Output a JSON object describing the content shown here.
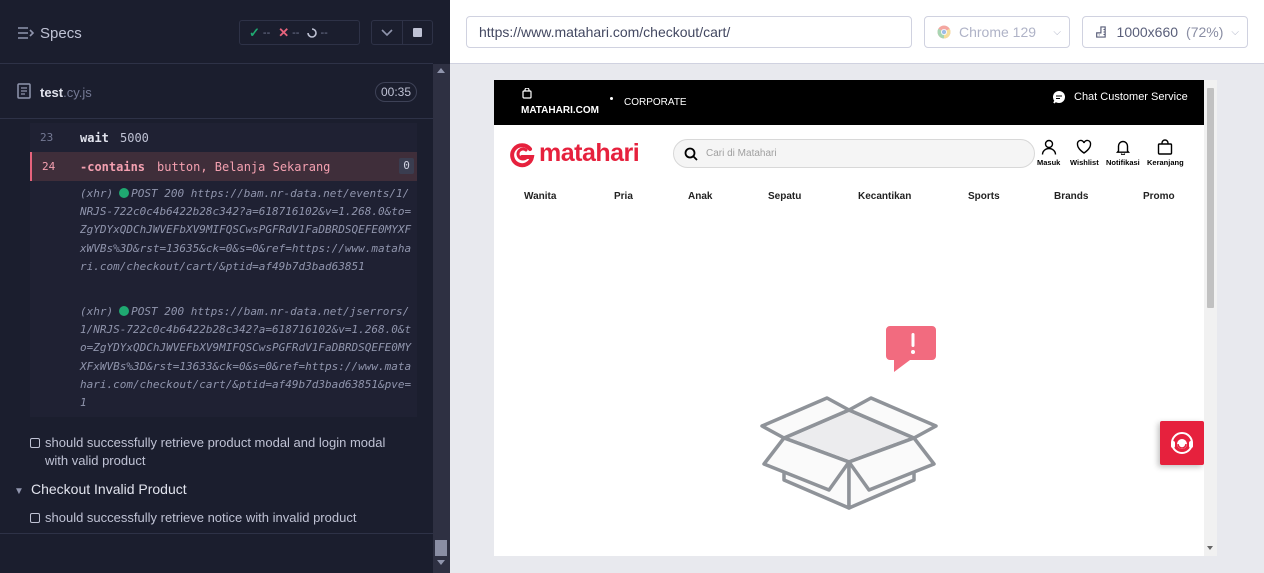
{
  "reporter": {
    "header": {
      "specs_label": "Specs",
      "stats": {
        "passed": "--",
        "failed": "--",
        "pending": "--"
      }
    },
    "spec": {
      "file_name": "test",
      "file_ext": ".cy.js",
      "duration": "00:35"
    },
    "commands": [
      {
        "num": "23",
        "name": "wait",
        "message": "5000"
      },
      {
        "num": "24",
        "name": "-contains",
        "message": "button, Belanja Sekarang",
        "badge": "0"
      }
    ],
    "xhr_logs": [
      {
        "prefix": "(xhr)",
        "method": "POST 200",
        "text": "https://bam.nr-data.net/events/1/NRJS-722c0c4b6422b28c342?a=618716102&v=1.268.0&to=ZgYDYxQDChJWVEFbXV9MIFQSCwsPGFRdV1FaDBRDSQEFE0MYXFxWVBs%3D&rst=13635&ck=0&s=0&ref=https://www.matahari.com/checkout/cart/&ptid=af49b7d3bad63851"
      },
      {
        "prefix": "(xhr)",
        "method": "POST 200",
        "text": "https://bam.nr-data.net/jserrors/1/NRJS-722c0c4b6422b28c342?a=618716102&v=1.268.0&to=ZgYDYxQDChJWVEFbXV9MIFQSCwsPGFRdV1FaDBRDSQEFE0MYXFxWVBs%3D&rst=13633&ck=0&s=0&ref=https://www.matahari.com/checkout/cart/&ptid=af49b7d3bad63851&pve=1"
      }
    ],
    "tests": [
      {
        "title": "should successfully retrieve product modal and login modal with valid product"
      },
      {
        "title": "should successfully retrieve notice with invalid product"
      }
    ],
    "suite_title": "Checkout Invalid Product"
  },
  "aut": {
    "url": "https://www.matahari.com/checkout/cart/",
    "browser": "Chrome 129",
    "viewport": "1000x660",
    "zoom": "(72%)"
  },
  "site": {
    "topbar": {
      "brand": "MATAHARI.COM",
      "corporate": "CORPORATE",
      "chat": "Chat Customer Service"
    },
    "logo_text": "matahari",
    "search_placeholder": "Cari di Matahari",
    "icons": [
      {
        "label": "Masuk",
        "icon": "user-icon"
      },
      {
        "label": "Wishlist",
        "icon": "heart-icon"
      },
      {
        "label": "Notifikasi",
        "icon": "bell-icon"
      },
      {
        "label": "Keranjang",
        "icon": "bag-icon"
      }
    ],
    "categories": [
      "Wanita",
      "Pria",
      "Anak",
      "Sepatu",
      "Kecantikan",
      "Sports",
      "Brands",
      "Promo"
    ],
    "brand_color": "#e6213d"
  }
}
